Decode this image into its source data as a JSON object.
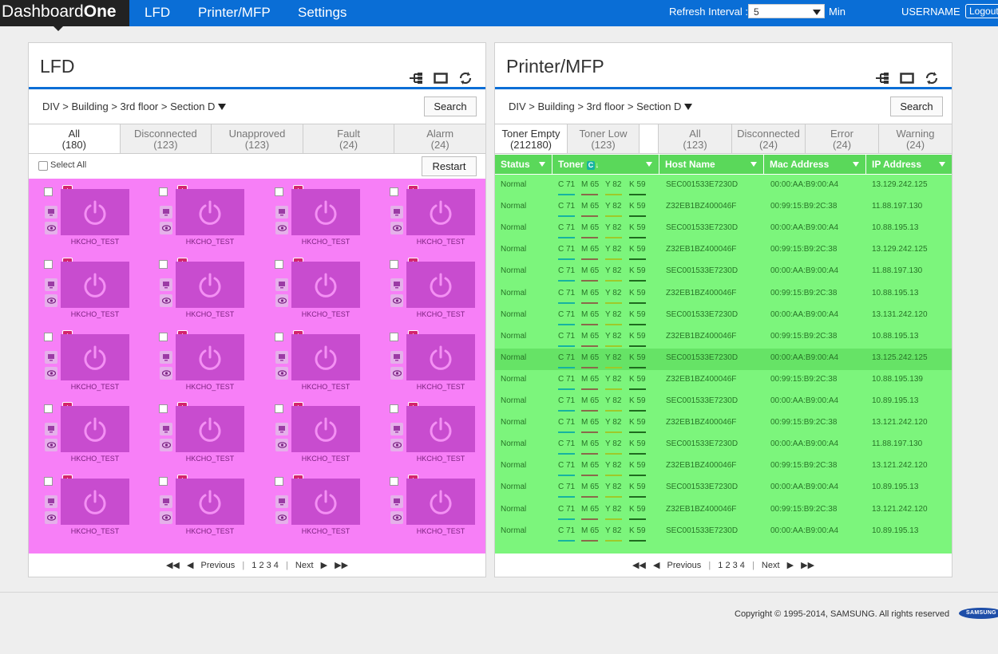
{
  "app": {
    "logo_prefix": "Dashboard",
    "logo_suffix": "One"
  },
  "nav": [
    {
      "label": "LFD"
    },
    {
      "label": "Printer/MFP"
    },
    {
      "label": "Settings"
    }
  ],
  "header": {
    "refresh_label": "Refresh Interval :",
    "refresh_value": "5",
    "refresh_unit": "Min",
    "username": "USERNAME",
    "logout": "Logout"
  },
  "lfd": {
    "title": "LFD",
    "breadcrumb": "DIV > Building > 3rd floor > Section D",
    "search": "Search",
    "tabs": [
      {
        "label": "All",
        "count": "(180)"
      },
      {
        "label": "Disconnected",
        "count": "(123)"
      },
      {
        "label": "Unapproved",
        "count": "(123)"
      },
      {
        "label": "Fault",
        "count": "(24)"
      },
      {
        "label": "Alarm",
        "count": "(24)"
      }
    ],
    "select_all": "Select All",
    "restart": "Restart",
    "device_name": "HKCHO_TEST",
    "alert_mark": "!",
    "pager": {
      "prev": "Previous",
      "pages": "1 2 3 4",
      "next": "Next"
    }
  },
  "printer": {
    "title": "Printer/MFP",
    "breadcrumb": "DIV > Building > 3rd floor > Section D",
    "search": "Search",
    "tabs_left": [
      {
        "label": "Toner Empty",
        "count": "(212180)"
      },
      {
        "label": "Toner Low",
        "count": "(123)"
      }
    ],
    "tabs_right": [
      {
        "label": "All",
        "count": "(123)"
      },
      {
        "label": "Disconnected",
        "count": "(24)"
      },
      {
        "label": "Error",
        "count": "(24)"
      },
      {
        "label": "Warning",
        "count": "(24)"
      }
    ],
    "columns": {
      "status": "Status",
      "toner": "Toner",
      "toner_badge": "C",
      "host": "Host Name",
      "mac": "Mac Address",
      "ip": "IP Address"
    },
    "toner_levels": {
      "c": "C 71",
      "m": "M 65",
      "y": "Y 82",
      "k": "K 59"
    },
    "rows": [
      {
        "status": "Normal",
        "host": "SEC001533E7230D",
        "mac": "00:00:AA:B9:00:A4",
        "ip": "13.129.242.125"
      },
      {
        "status": "Normal",
        "host": "Z32EB1BZ400046F",
        "mac": "00:99:15:B9:2C:38",
        "ip": "11.88.197.130"
      },
      {
        "status": "Normal",
        "host": "SEC001533E7230D",
        "mac": "00:00:AA:B9:00:A4",
        "ip": "10.88.195.13"
      },
      {
        "status": "Normal",
        "host": "Z32EB1BZ400046F",
        "mac": "00:99:15:B9:2C:38",
        "ip": "13.129.242.125"
      },
      {
        "status": "Normal",
        "host": "SEC001533E7230D",
        "mac": "00:00:AA:B9:00:A4",
        "ip": "11.88.197.130"
      },
      {
        "status": "Normal",
        "host": "Z32EB1BZ400046F",
        "mac": "00:99:15:B9:2C:38",
        "ip": "10.88.195.13"
      },
      {
        "status": "Normal",
        "host": "SEC001533E7230D",
        "mac": "00:00:AA:B9:00:A4",
        "ip": "13.131.242.120"
      },
      {
        "status": "Normal",
        "host": "Z32EB1BZ400046F",
        "mac": "00:99:15:B9:2C:38",
        "ip": "10.88.195.13"
      },
      {
        "status": "Normal",
        "host": "SEC001533E7230D",
        "mac": "00:00:AA:B9:00:A4",
        "ip": "13.125.242.125",
        "highlight": true
      },
      {
        "status": "Normal",
        "host": "Z32EB1BZ400046F",
        "mac": "00:99:15:B9:2C:38",
        "ip": "10.88.195.139"
      },
      {
        "status": "Normal",
        "host": "SEC001533E7230D",
        "mac": "00:00:AA:B9:00:A4",
        "ip": "10.89.195.13"
      },
      {
        "status": "Normal",
        "host": "Z32EB1BZ400046F",
        "mac": "00:99:15:B9:2C:38",
        "ip": "13.121.242.120"
      },
      {
        "status": "Normal",
        "host": "SEC001533E7230D",
        "mac": "00:00:AA:B9:00:A4",
        "ip": "11.88.197.130"
      },
      {
        "status": "Normal",
        "host": "Z32EB1BZ400046F",
        "mac": "00:99:15:B9:2C:38",
        "ip": "13.121.242.120"
      },
      {
        "status": "Normal",
        "host": "SEC001533E7230D",
        "mac": "00:00:AA:B9:00:A4",
        "ip": "10.89.195.13"
      },
      {
        "status": "Normal",
        "host": "Z32EB1BZ400046F",
        "mac": "00:99:15:B9:2C:38",
        "ip": "13.121.242.120"
      },
      {
        "status": "Normal",
        "host": "SEC001533E7230D",
        "mac": "00:00:AA:B9:00:A4",
        "ip": "10.89.195.13"
      }
    ],
    "pager": {
      "prev": "Previous",
      "pages": "1 2 3 4",
      "next": "Next"
    }
  },
  "footer": {
    "copyright": "Copyright © 1995-2014, SAMSUNG. All rights reserved",
    "brand": "SAMSUNG"
  },
  "colors": {
    "topbar": "#0a6ed6",
    "lfd_grid": "#f77ff7",
    "printer_table": "#7cf57c",
    "toner_c": "#16b3a0",
    "toner_m": "#8a6a4a",
    "toner_y": "#9ec92a",
    "toner_k": "#1f6b1f"
  },
  "icons": [
    "tree-icon",
    "window-icon",
    "refresh-icon",
    "power-icon",
    "checkbox-icon",
    "monitor-settings-icon",
    "eye-icon",
    "first-page-icon",
    "prev-page-icon",
    "next-page-icon",
    "last-page-icon"
  ]
}
